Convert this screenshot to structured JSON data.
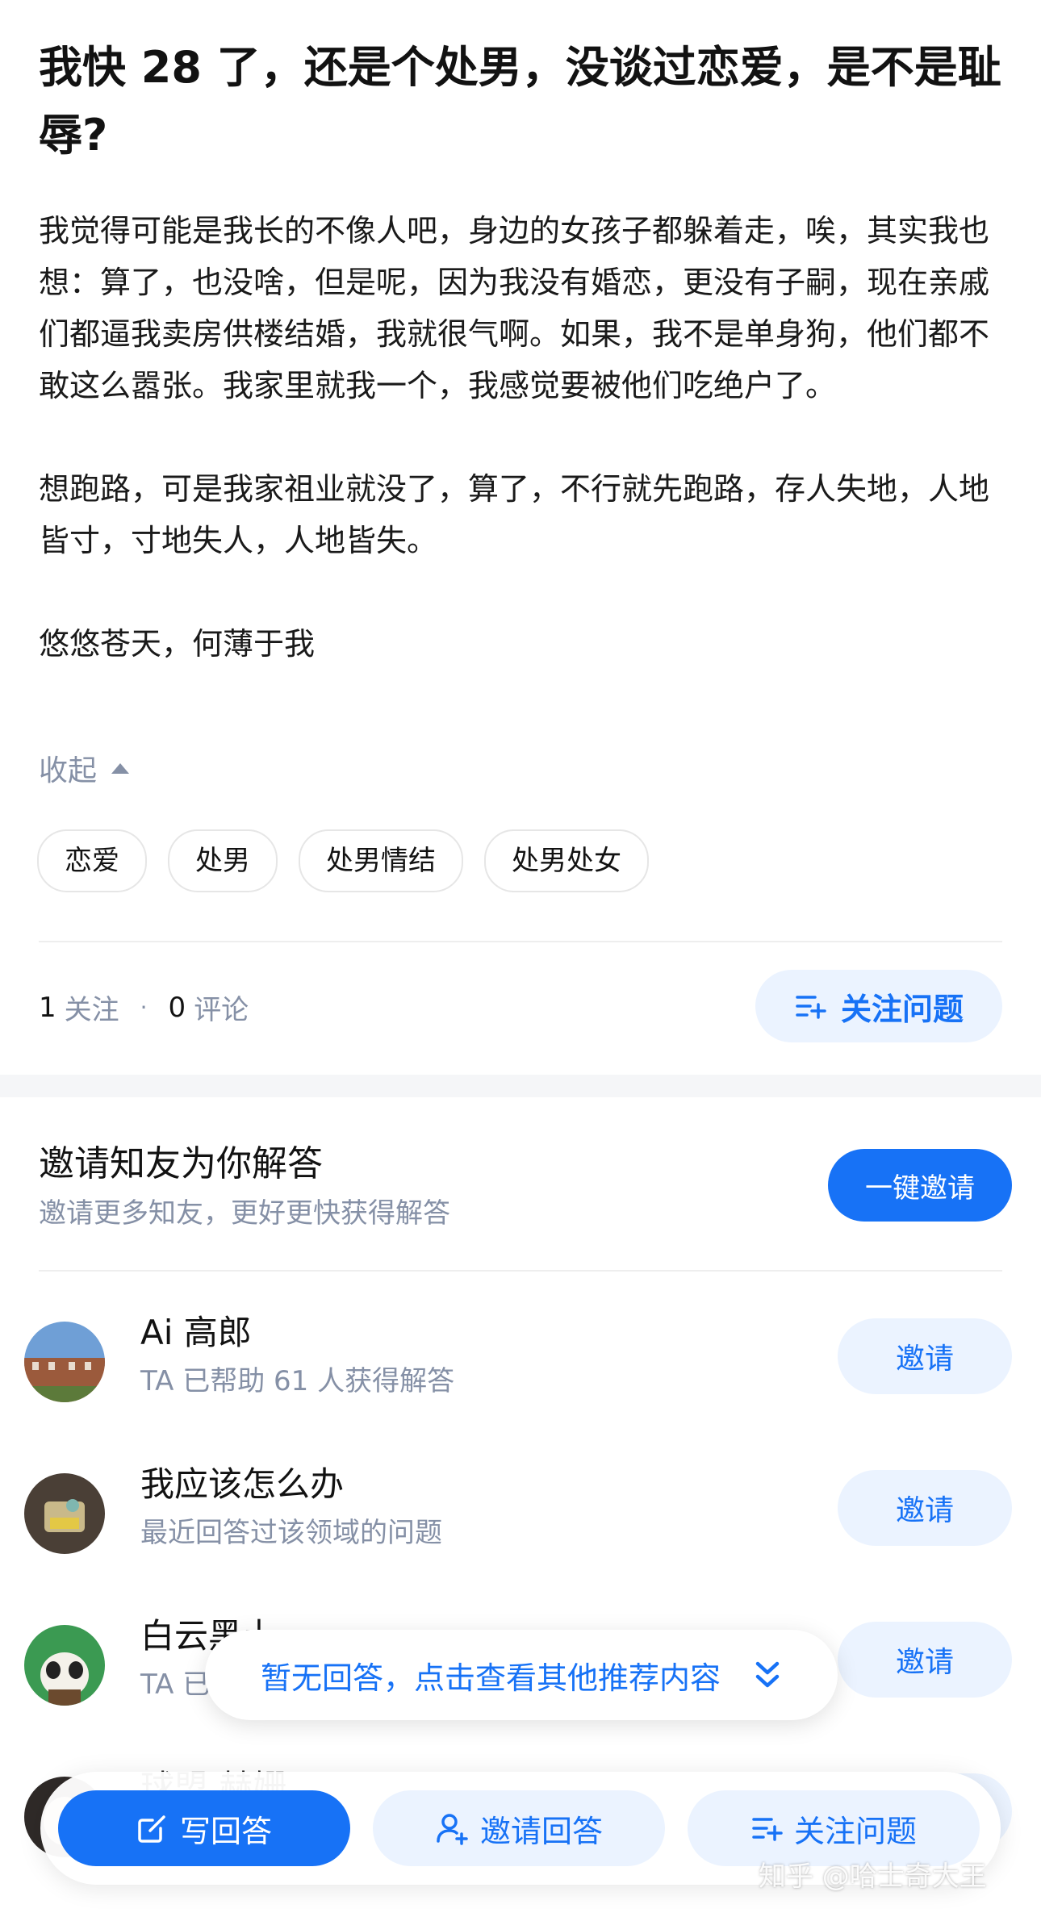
{
  "question": {
    "title": "我快 28 了，还是个处男，没谈过恋爱，是不是耻辱?",
    "paragraphs": [
      "我觉得可能是我长的不像人吧，身边的女孩子都躲着走，唉，其实我也想：算了，也没啥，但是呢，因为我没有婚恋，更没有子嗣，现在亲戚们都逼我卖房供楼结婚，我就很气啊。如果，我不是单身狗，他们都不敢这么嚣张。我家里就我一个，我感觉要被他们吃绝户了。",
      "想跑路，可是我家祖业就没了，算了，不行就先跑路，存人失地，人地皆寸，寸地失人，人地皆失。",
      "悠悠苍天，何薄于我"
    ],
    "collapse_label": "收起",
    "tags": [
      "恋爱",
      "处男",
      "处男情结",
      "处男处女"
    ],
    "follow_count": "1",
    "follow_label": "关注",
    "comment_count": "0",
    "comment_label": "评论",
    "follow_button": "关注问题"
  },
  "invite": {
    "title": "邀请知友为你解答",
    "subtitle": "邀请更多知友，更好更快获得解答",
    "invite_all_button": "一键邀请",
    "users": [
      {
        "name": "Ai 高郎",
        "desc": "TA 已帮助 61 人获得解答",
        "button": "邀请"
      },
      {
        "name": "我应该怎么办",
        "desc": "最近回答过该领域的问题",
        "button": "邀请"
      },
      {
        "name": "白云黑土",
        "desc": "TA 已",
        "button": "邀请"
      },
      {
        "name": "球盟 赫姗",
        "desc": "",
        "button": "邀请"
      }
    ]
  },
  "floating_tip": "暂无回答，点击查看其他推荐内容",
  "bottom_bar": {
    "write": "写回答",
    "invite": "邀请回答",
    "follow": "关注问题"
  },
  "watermark": "知乎 @哈士奇大王",
  "colors": {
    "accent": "#1772f6",
    "accent_light": "#ebf3ff",
    "muted": "#8590a6"
  }
}
